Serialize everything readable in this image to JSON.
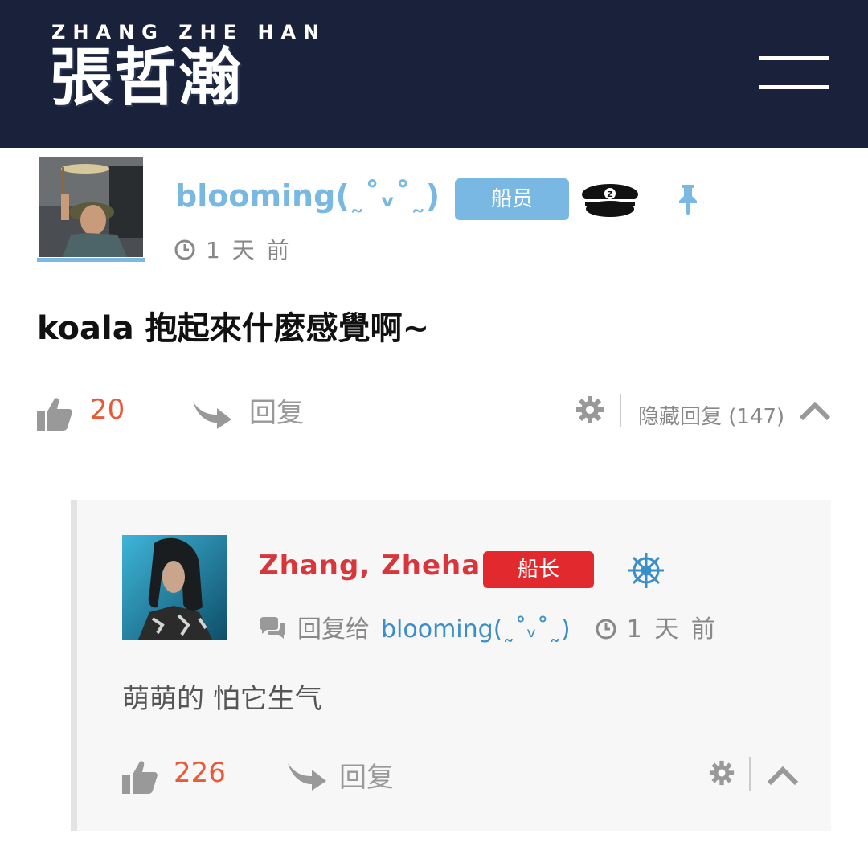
{
  "header": {
    "logo_subtitle": "ZHANG ZHE HAN",
    "logo_title": "張哲瀚",
    "menu_icon": "hamburger-menu-icon"
  },
  "post": {
    "username": "blooming(˷˚ᵥ˚˷)",
    "badge": "船员",
    "badge_color": "#79b8e2",
    "time": "1 天 前",
    "text": "koala 抱起來什麼感覺啊~",
    "likes": "20",
    "reply_label": "回复",
    "hide_replies_label": "隐藏回复 (147)"
  },
  "reply": {
    "username": "Zhang, Zhehan",
    "badge": "船长",
    "badge_color": "#e2292e",
    "reply_to_label": "回复给",
    "reply_to_user": "blooming(˷˚ᵥ˚˷)",
    "time": "1 天 前",
    "text": "萌萌的 怕它生气",
    "likes": "226",
    "reply_label": "回复"
  },
  "colors": {
    "header_bg": "#19223a",
    "accent_blue": "#79b8e2",
    "like_count": "#e75a3a"
  }
}
